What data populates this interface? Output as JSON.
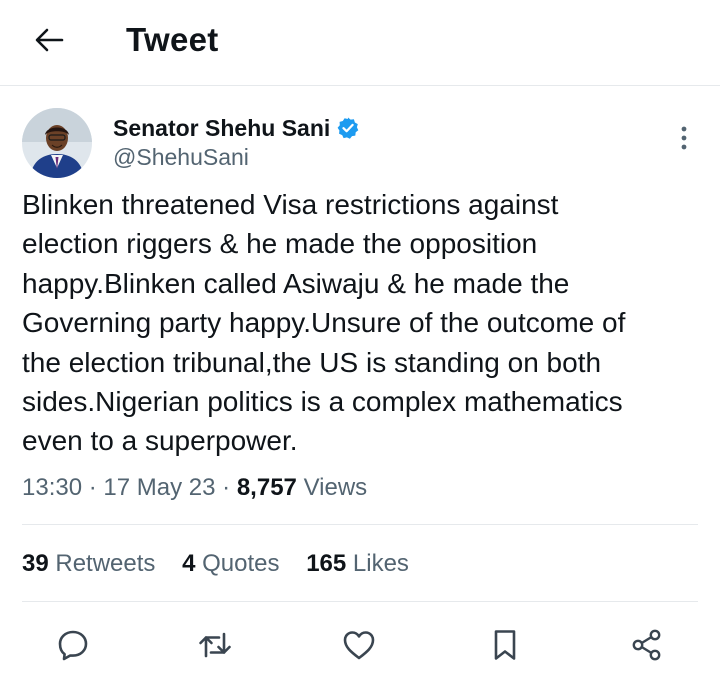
{
  "header": {
    "title": "Tweet",
    "back_icon": "arrow-left-icon"
  },
  "tweet": {
    "author": {
      "name": "Senator Shehu Sani",
      "handle": "@ShehuSani",
      "verified_icon": "verified-badge-icon",
      "avatar_icon": "avatar-photo"
    },
    "text_lines": [
      "Blinken threatened Visa restrictions against",
      "election riggers & he made the opposition",
      "happy.Blinken called Asiwaju & he made the",
      "Governing party happy.Unsure of the outcome of",
      "the election tribunal,the US is standing on both",
      "sides.Nigerian politics is a complex mathematics",
      "even to a superpower."
    ],
    "time": "13:30",
    "date": "17 May 23",
    "separator": "·",
    "views_count": "8,757",
    "views_label": "Views"
  },
  "stats": {
    "retweets_count": "39",
    "retweets_label": "Retweets",
    "quotes_count": "4",
    "quotes_label": "Quotes",
    "likes_count": "165",
    "likes_label": "Likes"
  },
  "actions": [
    "reply-icon",
    "retweet-icon",
    "like-icon",
    "bookmark-icon",
    "share-icon"
  ],
  "colors": {
    "text": "#0f1419",
    "secondary": "#536471",
    "verified": "#1d9bf0",
    "divider": "#e6e9ec"
  }
}
